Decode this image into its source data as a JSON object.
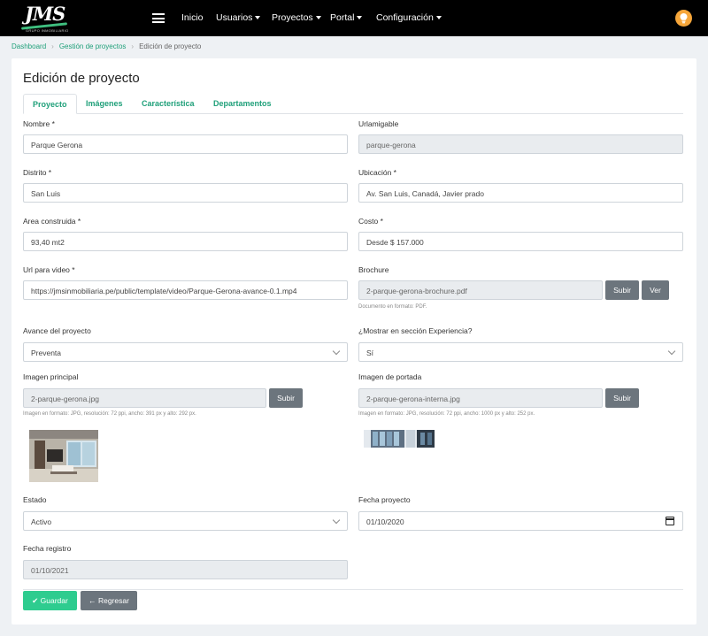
{
  "brand": {
    "mark": "JMS",
    "subtitle": "GRUPO INMOBILIARIO"
  },
  "nav": {
    "items": [
      {
        "label": "Inicio"
      },
      {
        "label": "Usuarios"
      },
      {
        "label": "Proyectos"
      },
      {
        "label": "Portal"
      },
      {
        "label": "Configuración"
      }
    ]
  },
  "breadcrumb": [
    "Dashboard",
    "Gestión de proyectos",
    "Edición de proyecto"
  ],
  "page_title": "Edición de proyecto",
  "tabs": [
    {
      "label": "Proyecto",
      "active": true
    },
    {
      "label": "Imágenes",
      "active": false
    },
    {
      "label": "Característica",
      "active": false
    },
    {
      "label": "Departamentos",
      "active": false
    }
  ],
  "form": {
    "nombre": {
      "label": "Nombre *",
      "value": "Parque Gerona"
    },
    "urlamigable": {
      "label": "Urlamigable",
      "value": "parque-gerona"
    },
    "distrito": {
      "label": "Distrito *",
      "value": "San Luis"
    },
    "ubicacion": {
      "label": "Ubicación *",
      "value": "Av. San Luis, Canadá, Javier prado"
    },
    "area": {
      "label": "Area construida *",
      "value": "93,40 mt2"
    },
    "costo": {
      "label": "Costo *",
      "value": "Desde $ 157.000"
    },
    "url_video": {
      "label": "Url para video *",
      "value": "https://jmsinmobiliaria.pe/public/template/video/Parque-Gerona-avance-0.1.mp4"
    },
    "brochure": {
      "label": "Brochure",
      "value": "2-parque-gerona-brochure.pdf",
      "help": "Documento en formato: PDF.",
      "upload_label": "Subir",
      "view_label": "Ver"
    },
    "avance": {
      "label": "Avance del proyecto",
      "value": "Preventa"
    },
    "experiencia": {
      "label": "¿Mostrar en sección Experiencia?",
      "value": "Sí"
    },
    "imagen_principal": {
      "label": "Imagen principal",
      "value": "2-parque-gerona.jpg",
      "upload_label": "Subir",
      "help": "Imagen en formato: JPG, resolución: 72 ppi, ancho: 391 px y alto: 292 px."
    },
    "imagen_portada": {
      "label": "Imagen de portada",
      "value": "2-parque-gerona-interna.jpg",
      "upload_label": "Subir",
      "help": "Imagen en formato: JPG, resolución: 72 ppi, ancho: 1000 px y alto: 252 px."
    },
    "estado": {
      "label": "Estado",
      "value": "Activo"
    },
    "fecha_proyecto": {
      "label": "Fecha proyecto",
      "value": "01/10/2020"
    },
    "fecha_registro": {
      "label": "Fecha registro",
      "value": "01/10/2021"
    }
  },
  "actions": {
    "save_label": "Guardar",
    "back_label": "Regresar"
  },
  "colors": {
    "accent": "#20a07a",
    "save": "#2ecc8f",
    "secondary": "#6c757d",
    "navbar": "#000000",
    "bulb": "#f6a63a"
  }
}
